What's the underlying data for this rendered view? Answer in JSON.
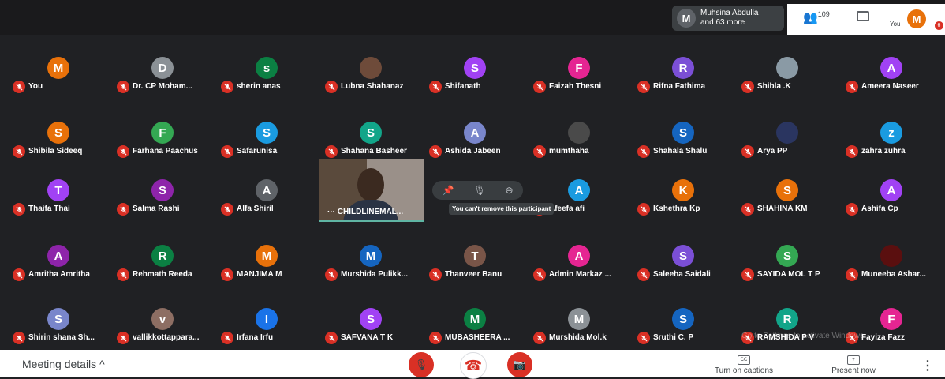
{
  "top": {
    "presence_initial": "M",
    "presence_line1": "Muhsina Abdulla",
    "presence_line2": "and 63 more",
    "people_count": "109",
    "you_label": "You",
    "you_initial": "M",
    "notif": "6"
  },
  "participants": [
    {
      "name": "You",
      "initial": "M",
      "color": "#e8710a"
    },
    {
      "name": "Dr. CP Moham...",
      "initial": "D",
      "color": "#8b9196"
    },
    {
      "name": "sherin anas",
      "initial": "s",
      "color": "#0b8043"
    },
    {
      "name": "Lubna Shahanaz",
      "initial": "",
      "color": "#6e4b3a"
    },
    {
      "name": "Shifanath",
      "initial": "S",
      "color": "#a142f4"
    },
    {
      "name": "Faizah Thesni",
      "initial": "F",
      "color": "#e52592"
    },
    {
      "name": "Rifna Fathima",
      "initial": "R",
      "color": "#7b4fd6"
    },
    {
      "name": "Shibla .K",
      "initial": "",
      "color": "#8a9aa5"
    },
    {
      "name": "Ameera Naseer",
      "initial": "A",
      "color": "#a142f4"
    },
    {
      "name": "Shibila Sideeq",
      "initial": "S",
      "color": "#e8710a"
    },
    {
      "name": "Farhana Paachus",
      "initial": "F",
      "color": "#34a853"
    },
    {
      "name": "Safarunisa",
      "initial": "S",
      "color": "#1a9be0"
    },
    {
      "name": "Shahana Basheer",
      "initial": "S",
      "color": "#12a589"
    },
    {
      "name": "Ashida Jabeen",
      "initial": "A",
      "color": "#7986cb"
    },
    {
      "name": "mumthaha",
      "initial": "",
      "color": "#4a4a4a"
    },
    {
      "name": "Shahala Shalu",
      "initial": "S",
      "color": "#1565c0"
    },
    {
      "name": "Arya PP",
      "initial": "",
      "color": "#2a3560"
    },
    {
      "name": "zahra zuhra",
      "initial": "z",
      "color": "#1a9be0"
    },
    {
      "name": "Thaifa Thai",
      "initial": "T",
      "color": "#a142f4"
    },
    {
      "name": "Salma Rashi",
      "initial": "S",
      "color": "#8e24aa"
    },
    {
      "name": "Alfa Shiril",
      "initial": "A",
      "color": "#5f6368"
    },
    {
      "name": "Afeefa afi",
      "initial": "A",
      "color": "#1a9be0"
    },
    {
      "name": "Kshethra Kp",
      "initial": "K",
      "color": "#e8710a"
    },
    {
      "name": "SHAHINA KM",
      "initial": "S",
      "color": "#e8710a"
    },
    {
      "name": "Ashifa Cp",
      "initial": "A",
      "color": "#a142f4"
    },
    {
      "name": "Amritha Amritha",
      "initial": "A",
      "color": "#8e24aa"
    },
    {
      "name": "Rehmath Reeda",
      "initial": "R",
      "color": "#0b8043"
    },
    {
      "name": "MANJIMA M",
      "initial": "M",
      "color": "#e8710a"
    },
    {
      "name": "Murshida Pulikk...",
      "initial": "M",
      "color": "#1565c0"
    },
    {
      "name": "Thanveer Banu",
      "initial": "T",
      "color": "#795548"
    },
    {
      "name": "Admin Markaz ...",
      "initial": "A",
      "color": "#e52592"
    },
    {
      "name": "Saleeha Saidali",
      "initial": "S",
      "color": "#7b4fd6"
    },
    {
      "name": "SAYIDA MOL T P",
      "initial": "S",
      "color": "#34a853"
    },
    {
      "name": "Muneeba Ashar...",
      "initial": "",
      "color": "#5a0f0f"
    },
    {
      "name": "Shirin shana Sh...",
      "initial": "S",
      "color": "#7986cb"
    },
    {
      "name": "vallikkottappara...",
      "initial": "v",
      "color": "#8d6e63"
    },
    {
      "name": "Irfana Irfu",
      "initial": "I",
      "color": "#1a73e8"
    },
    {
      "name": "SAFVANA T K",
      "initial": "S",
      "color": "#a142f4"
    },
    {
      "name": "MUBASHEERA ...",
      "initial": "M",
      "color": "#0b8043"
    },
    {
      "name": "Murshida Mol.k",
      "initial": "M",
      "color": "#8b9196"
    },
    {
      "name": "Sruthi C. P",
      "initial": "S",
      "color": "#1565c0"
    },
    {
      "name": "RAMSHIDA P V",
      "initial": "R",
      "color": "#12a589"
    },
    {
      "name": "Fayiza Fazz",
      "initial": "F",
      "color": "#e52592"
    }
  ],
  "video": {
    "name": "CHILDLINEMAL..."
  },
  "tooltip": "You can't remove this participant",
  "watermark": "Go to Settings to activate Windows.",
  "bottom": {
    "meeting_details": "Meeting details",
    "captions_label": "Turn on captions",
    "captions_icon": "CC",
    "present_label": "Present now",
    "more_icon": "⋮"
  }
}
